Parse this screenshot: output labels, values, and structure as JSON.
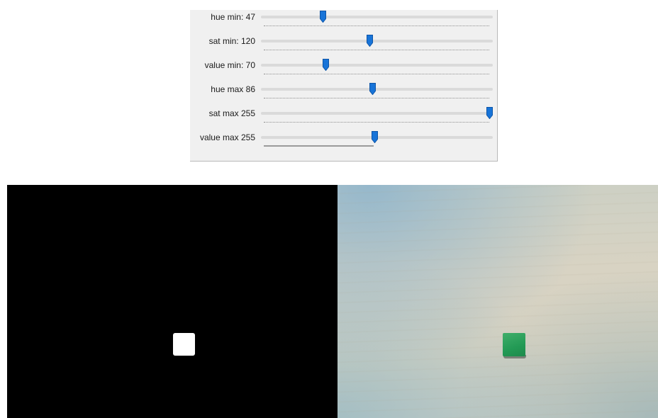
{
  "trackbars": [
    {
      "label": "hue min: 47",
      "value": 47,
      "max": 179
    },
    {
      "label": "sat min: 120",
      "value": 120,
      "max": 255
    },
    {
      "label": "value min: 70",
      "value": 70,
      "max": 255
    },
    {
      "label": "hue max 86",
      "value": 86,
      "max": 179
    },
    {
      "label": "sat max 255",
      "value": 255,
      "max": 255
    },
    {
      "label": "value max 255",
      "value": 255,
      "max": 255
    }
  ],
  "colors": {
    "thumb": "#1874d8",
    "thumb_edge": "#0d55a8",
    "mask_background": "#000000",
    "mask_blob": "#ffffff",
    "cube": "#239a55"
  },
  "icons": {
    "thumb": "slider-thumb-icon"
  }
}
